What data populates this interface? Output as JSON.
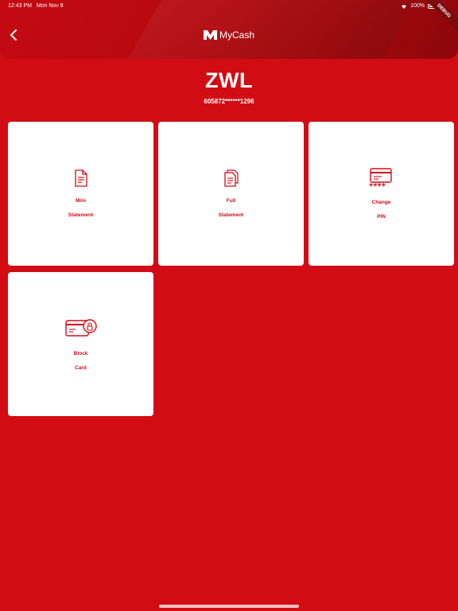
{
  "status_bar": {
    "time": "12:43 PM",
    "date": "Mon Nov 8",
    "battery": "100%"
  },
  "debug_ribbon": "DEBUG",
  "header": {
    "brand_name": "MyCash",
    "back_icon": "chevron-left-icon"
  },
  "account": {
    "currency": "ZWL",
    "card_number": "605872******1296"
  },
  "tiles": [
    {
      "line1": "Mini",
      "line2": "Statement",
      "icon": "document-icon"
    },
    {
      "line1": "Full",
      "line2": "Statement",
      "icon": "documents-stack-icon"
    },
    {
      "line1": "Change",
      "line2": "PIN",
      "icon": "card-pin-icon"
    },
    {
      "line1": "Block",
      "line2": "Card",
      "icon": "card-lock-icon"
    }
  ],
  "colors": {
    "background": "#d20c14",
    "accent": "#d20c14",
    "tile": "#ffffff",
    "header_dark": "#8e070b"
  }
}
